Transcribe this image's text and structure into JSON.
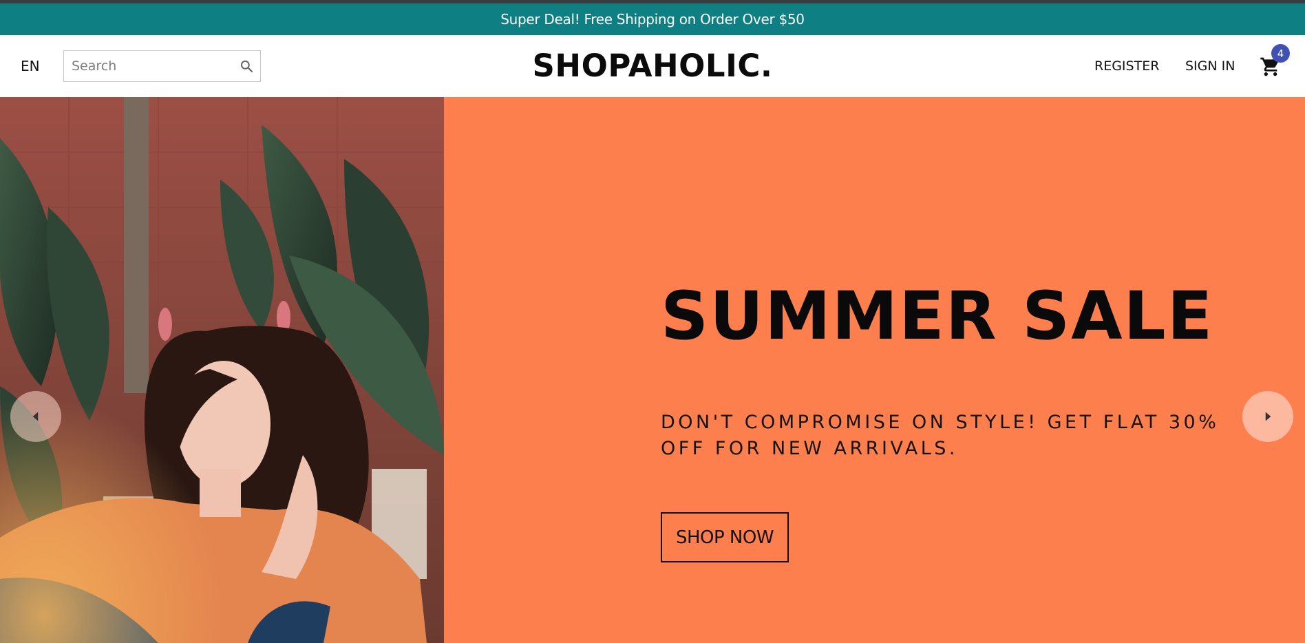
{
  "announcement": {
    "text": "Super Deal! Free Shipping on Order Over $50"
  },
  "navbar": {
    "language": "EN",
    "search": {
      "placeholder": "Search",
      "icon": "search-icon"
    },
    "logo": "SHOPAHOLIC.",
    "links": {
      "register": "REGISTER",
      "sign_in": "SIGN IN"
    },
    "cart": {
      "icon": "cart-icon",
      "count": "4"
    }
  },
  "slider": {
    "title": "SUMMER SALE",
    "description": "DON'T COMPROMISE ON STYLE! GET FLAT 30% OFF FOR NEW ARRIVALS.",
    "cta_label": "SHOP NOW",
    "prev_icon": "arrow-left-icon",
    "next_icon": "arrow-right-icon"
  },
  "colors": {
    "announcement_bg": "#0e8083",
    "hero_bg": "#fe7f4e",
    "badge_bg": "#3f51b5",
    "shirt": "#e4854f"
  }
}
